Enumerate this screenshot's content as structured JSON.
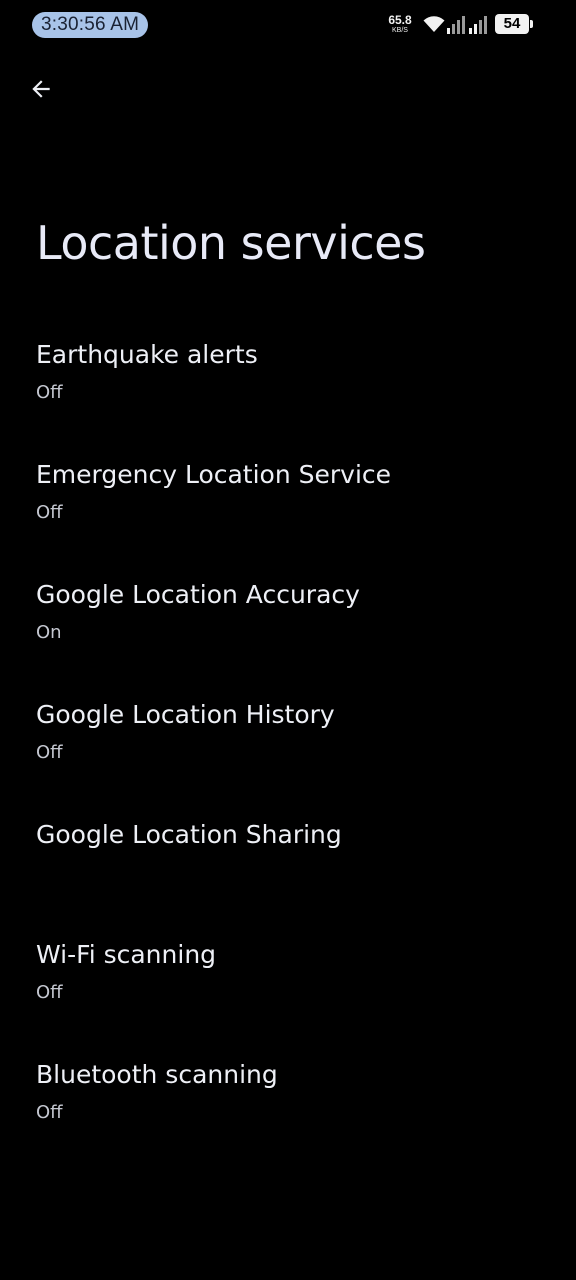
{
  "status_bar": {
    "time": "3:30:56 AM",
    "net_speed_value": "65.8",
    "net_speed_unit": "KB/S",
    "battery_level": "54",
    "icons": [
      "wifi-icon",
      "signal-icon",
      "signal-icon",
      "battery-icon"
    ]
  },
  "toolbar": {
    "back_icon": "back-arrow-icon"
  },
  "page": {
    "title": "Location services"
  },
  "settings": [
    {
      "title": "Earthquake alerts",
      "summary": "Off"
    },
    {
      "title": "Emergency Location Service",
      "summary": "Off"
    },
    {
      "title": "Google Location Accuracy",
      "summary": "On"
    },
    {
      "title": "Google Location History",
      "summary": "Off"
    },
    {
      "title": "Google Location Sharing",
      "summary": ""
    },
    {
      "title": "Wi-Fi scanning",
      "summary": "Off"
    },
    {
      "title": "Bluetooth scanning",
      "summary": "Off"
    }
  ],
  "colors": {
    "background": "#000000",
    "time_pill": "#a8c3e8",
    "title_text": "#e8eaf7",
    "summary_text": "#c4c7d0"
  }
}
